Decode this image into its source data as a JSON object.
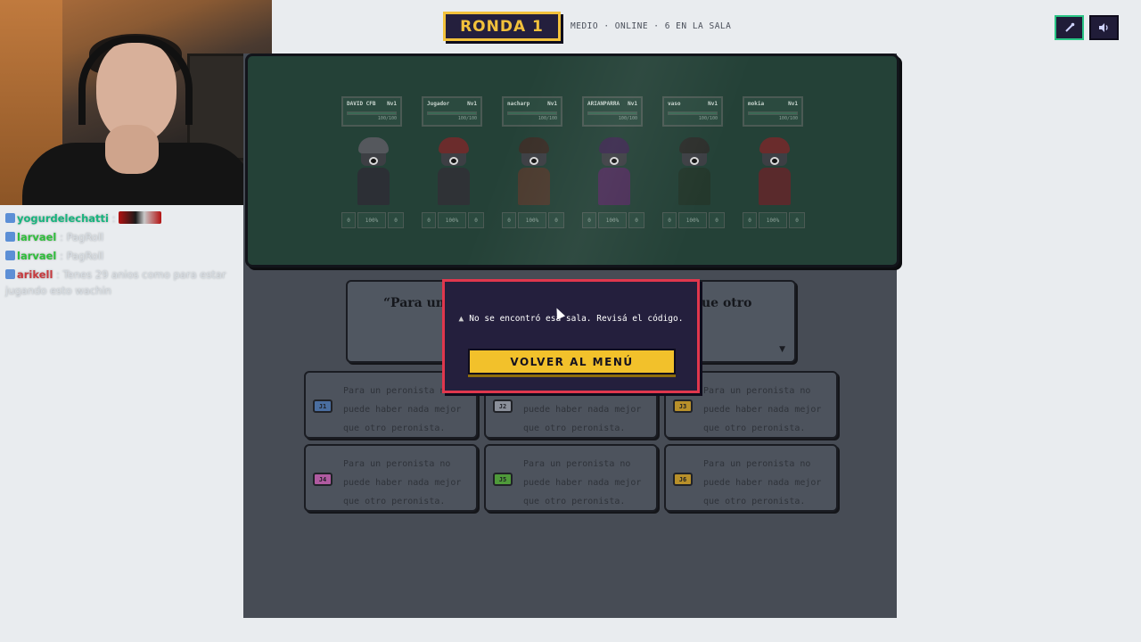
{
  "header": {
    "round_label": "RONDA 1",
    "room_info": "MEDIO · ONLINE · 6 EN LA SALA"
  },
  "controls": {
    "mic_icon": "mic-icon",
    "volume_icon": "volume-icon"
  },
  "chat": [
    {
      "user": "yogurdelechatti",
      "color": "#17b57e",
      "text": "",
      "emote": "red-emote"
    },
    {
      "user": "larvael",
      "color": "#2fbf3b",
      "text": "PagRoll"
    },
    {
      "user": "larvael",
      "color": "#2fbf3b",
      "text": "PagRoll"
    },
    {
      "user": "arikell",
      "color": "#c8383c",
      "text": "Tenes 29 anios como para estar jugando esto wachin"
    }
  ],
  "players": [
    {
      "name": "DAVID CFB",
      "tag": "Nv1",
      "hp": "100/100",
      "stats": [
        "0",
        "100%",
        "0"
      ],
      "hair": "#55585d",
      "body": "#2c2f35",
      "x": 0
    },
    {
      "name": "Jugador",
      "tag": "Nv1",
      "hp": "100/100",
      "stats": [
        "0",
        "100%",
        "0"
      ],
      "hair": "#6b2c2c",
      "body": "#2f3236",
      "x": 1
    },
    {
      "name": "nacharp",
      "tag": "Nv1",
      "hp": "100/100",
      "stats": [
        "0",
        "100%",
        "0"
      ],
      "hair": "#3a2f28",
      "body": "#4b3a2e",
      "x": 2
    },
    {
      "name": "ARIANPARRA",
      "tag": "Nv1",
      "hp": "100/100",
      "stats": [
        "0",
        "100%",
        "0"
      ],
      "hair": "#3a2a4d",
      "body": "#4a2e57",
      "x": 3
    },
    {
      "name": "vaso",
      "tag": "Nv1",
      "hp": "100/100",
      "stats": [
        "0",
        "100%",
        "0"
      ],
      "hair": "#2d2f2c",
      "body": "#24382c",
      "x": 4
    },
    {
      "name": "mokia",
      "tag": "Nv1",
      "hp": "100/100",
      "stats": [
        "0",
        "100%",
        "0"
      ],
      "hair": "#6a2c2c",
      "body": "#5a2a2c",
      "x": 5
    }
  ],
  "question": {
    "text_left": "“Para un",
    "text_right": "ue otro",
    "more_icon": "chevron-down-icon"
  },
  "answers": [
    {
      "tag": "J1",
      "color": "#4a6ea0",
      "text": "Para un peronista no puede haber nada mejor que otro peronista."
    },
    {
      "tag": "J2",
      "color": "#8a8f99",
      "text": "Para un peronista no puede haber nada mejor que otro peronista."
    },
    {
      "tag": "J3",
      "color": "#b8902a",
      "text": "Para un peronista no puede haber nada mejor que otro peronista."
    },
    {
      "tag": "J4",
      "color": "#b05aa0",
      "text": "Para un peronista no puede haber nada mejor que otro peronista."
    },
    {
      "tag": "J5",
      "color": "#4f9a3a",
      "text": "Para un peronista no puede haber nada mejor que otro peronista."
    },
    {
      "tag": "J6",
      "color": "#b8902a",
      "text": "Para un peronista no puede haber nada mejor que otro peronista."
    }
  ],
  "modal": {
    "icon": "warning-icon",
    "message": "No se encontró esa sala. Revisá el código.",
    "button_label": "VOLVER AL MENÚ"
  }
}
